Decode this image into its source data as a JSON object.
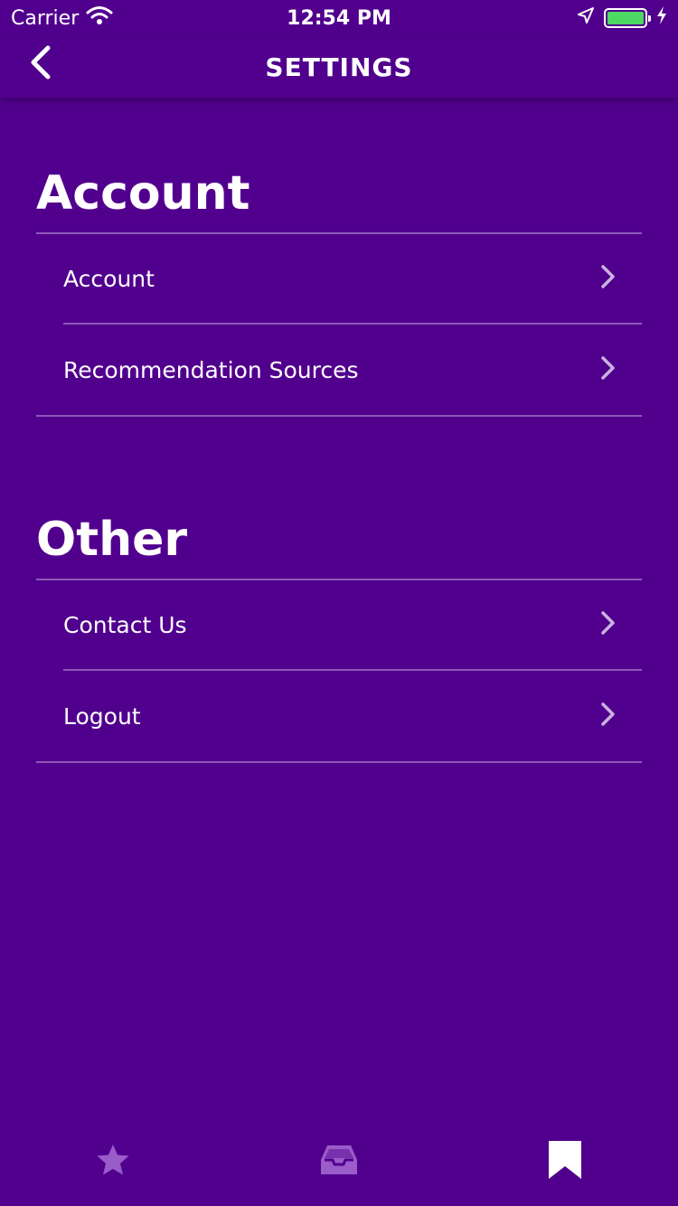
{
  "status_bar": {
    "carrier": "Carrier",
    "time": "12:54 PM",
    "battery_color": "#4cd964"
  },
  "nav": {
    "title": "SETTINGS",
    "back_icon": "chevron-left-icon"
  },
  "sections": [
    {
      "title": "Account",
      "items": [
        {
          "label": "Account"
        },
        {
          "label": "Recommendation Sources"
        }
      ]
    },
    {
      "title": "Other",
      "items": [
        {
          "label": "Contact Us"
        },
        {
          "label": "Logout"
        }
      ]
    }
  ],
  "tabs": [
    {
      "icon": "star-icon",
      "active": false
    },
    {
      "icon": "inbox-icon",
      "active": false
    },
    {
      "icon": "bookmark-icon",
      "active": true
    }
  ],
  "colors": {
    "background": "#51008e",
    "inactive_tab": "#9a5cc9",
    "active_tab": "#ffffff",
    "chevron": "#c9b3df"
  }
}
